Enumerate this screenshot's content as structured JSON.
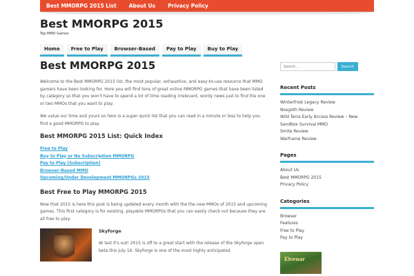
{
  "topbar": {
    "links": [
      "Best MMORPG 2015 List",
      "About Us",
      "Privacy Policy"
    ]
  },
  "site": {
    "title": "Best MMORPG 2015",
    "tagline": "Top MMO Games"
  },
  "nav": {
    "items": [
      "Home",
      "Free to Play",
      "Browser-Based",
      "Pay to Play",
      "Buy to Play"
    ]
  },
  "main": {
    "heading": "Best MMORPG 2015",
    "intro1": "Welcome to the Best MMORPG 2015 list, the most popular, exhaustive, and easy-to-use resource that MMO gamers have been looking for. Here you will find tons of great online MMORPG games that have been listed by category so that you won't have to spend a lot of time reading irrelevant, wordy news just to find the one or two MMOs that you want to play.",
    "intro2": "We value our time and yours so here is a super quick list that you can read in a minute or less to help you find a good MMORPG to play.",
    "index_heading": "Best MMORPG 2015 List: Quick Index",
    "index_links": [
      "Free to Play",
      "Buy to Play or No Subscription MMORPG",
      "Pay to Play (Subscription)",
      "Browser-Based MMO",
      "Upcoming/Under Development MMORPGs 2015"
    ],
    "f2p_heading": "Best Free to Play MMORPG 2015",
    "f2p_text": "Now that 2015 is here this post is being updated every month with the the new MMOs of 2015 and upcoming games. This first category is for existing, playable MMORPGs that you can easily check out because they are all free to play.",
    "game_title": "Skyforge",
    "game_text": "At last it's out! 2015 is off to a great start with the release of the Skyforge open beta this july 16. Skyforge is one of the most highly anticipated"
  },
  "sidebar": {
    "search_placeholder": "Search ...",
    "search_button": "Search",
    "recent_title": "Recent Posts",
    "recent_posts": [
      "Winterfrost Legacy Review",
      "Nosgoth Review",
      "Wild Terra Early Access Review – New Sandbox Survival MMO",
      "Smite Review",
      "Warframe Review"
    ],
    "pages_title": "Pages",
    "pages": [
      "About Us",
      "Best MMORPG 2015",
      "Privacy Policy"
    ],
    "categories_title": "Categories",
    "categories": [
      "Browser",
      "Features",
      "Free to Play",
      "Pay to Play"
    ],
    "ad_text": "Elvenar"
  },
  "colors": {
    "topbar": "#e84c2f",
    "accent": "#3aafd1",
    "link": "#2a9fd6"
  }
}
